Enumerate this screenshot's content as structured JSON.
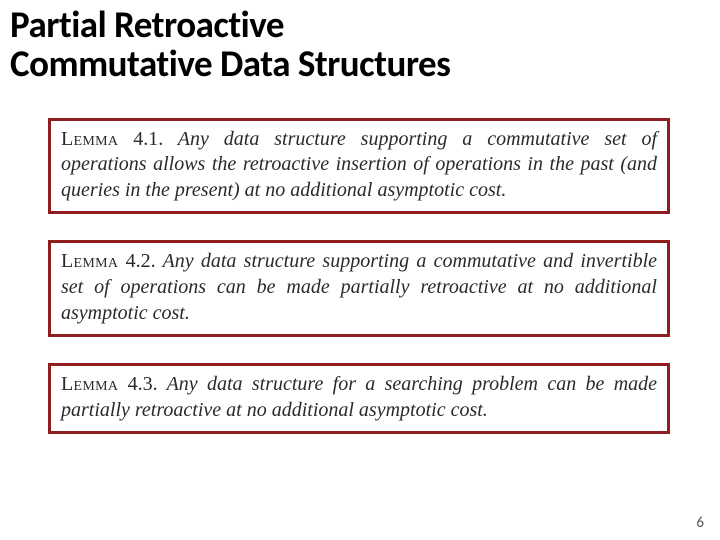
{
  "title": {
    "line1": "Partial Retroactive",
    "line2": "Commutative Data Structures"
  },
  "lemmas": [
    {
      "label": "Lemma",
      "number": "4.1.",
      "text": "Any data structure supporting a commutative set of operations allows the retroactive insertion of operations in the past (and queries in the present) at no additional asymptotic cost."
    },
    {
      "label": "Lemma",
      "number": "4.2.",
      "text": "Any data structure supporting a commutative and invertible set of operations can be made partially retroactive at no additional asymptotic cost."
    },
    {
      "label": "Lemma",
      "number": "4.3.",
      "text": "Any data structure for a searching problem can be made partially retroactive at no additional asymptotic cost."
    }
  ],
  "page_number": "6"
}
